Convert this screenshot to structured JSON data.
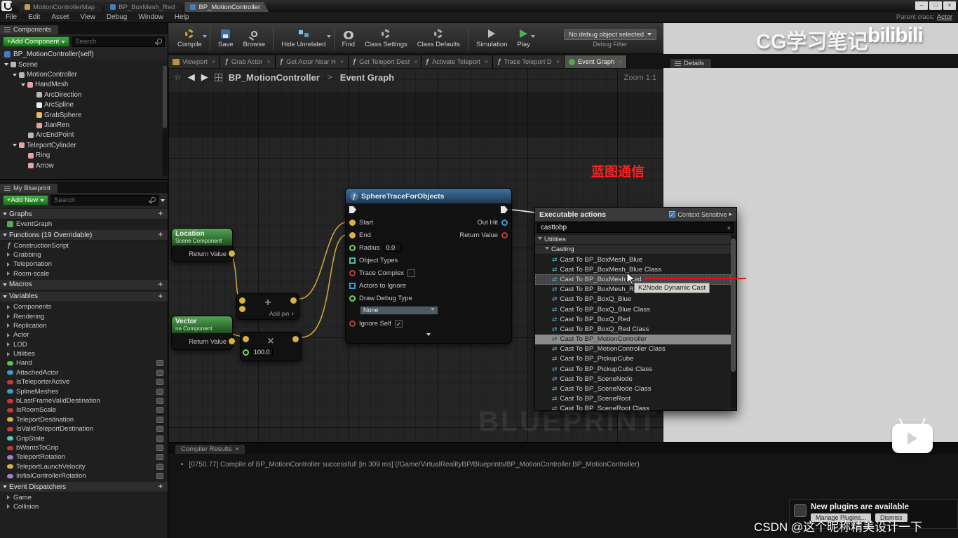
{
  "glyphs": {
    "plus": "+",
    "check": "✓",
    "fn": "ƒ",
    "cast": "⇄",
    "close": "×",
    "bullet": "•",
    "star": "☆",
    "back": "◀",
    "forward": "▶",
    "context_arrow": "▸",
    "window_min": "–",
    "window_max": "□",
    "window_close": "×"
  },
  "colors": {
    "accent_green": "#3fae3f",
    "annotation_red": "#ee1111",
    "vector_gold": "#d8b33f",
    "bool_red": "#c23b3b",
    "object_blue": "#3f9bd8",
    "node_header_blue": "#3e719f",
    "node_header_green": "#55a255"
  },
  "window": {
    "doc_tabs": [
      {
        "label": "MotionControllerMap",
        "icon": "level-icon",
        "active": false
      },
      {
        "label": "BP_BoxMesh_Red",
        "icon": "blueprint-icon",
        "active": false
      },
      {
        "label": "BP_MotionController",
        "icon": "blueprint-icon",
        "active": true
      }
    ],
    "menu_items": [
      "File",
      "Edit",
      "Asset",
      "View",
      "Debug",
      "Window",
      "Help"
    ],
    "parent_class_label": "Parent class:",
    "parent_class_value": "Actor"
  },
  "components_panel": {
    "tab_label": "Components",
    "add_button_label": "+Add Component",
    "search_placeholder": "Search",
    "root_label": "BP_MotionController(self)",
    "tree": [
      {
        "label": "Scene",
        "depth": 0,
        "expander": true,
        "color": "#b8b8b8"
      },
      {
        "label": "MotionController",
        "depth": 1,
        "expander": true,
        "color": "#b8b8b8"
      },
      {
        "label": "HandMesh",
        "depth": 2,
        "expander": true,
        "color": "#e8a1a1"
      },
      {
        "label": "ArcDirection",
        "depth": 3,
        "expander": false,
        "color": "#b8b8b8"
      },
      {
        "label": "ArcSpline",
        "depth": 3,
        "expander": false,
        "color": "#f0f0f0"
      },
      {
        "label": "GrabSphere",
        "depth": 3,
        "expander": false,
        "color": "#f0b860"
      },
      {
        "label": "JianRen",
        "depth": 3,
        "expander": false,
        "color": "#e8a1a1"
      },
      {
        "label": "ArcEndPoint",
        "depth": 2,
        "expander": false,
        "color": "#b8b8b8"
      },
      {
        "label": "TeleportCylinder",
        "depth": 1,
        "expander": true,
        "color": "#e8a1a1"
      },
      {
        "label": "Ring",
        "depth": 2,
        "expander": false,
        "color": "#e8a1a1"
      },
      {
        "label": "Arrow",
        "depth": 2,
        "expander": false,
        "color": "#e8a1a1"
      }
    ]
  },
  "myblueprint_panel": {
    "tab_label": "My Blueprint",
    "add_button_label": "+Add New",
    "search_placeholder": "Search",
    "sections": [
      {
        "label": "Graphs",
        "items": [
          {
            "label": "EventGraph",
            "type": "graph"
          }
        ]
      },
      {
        "label": "Functions (19 Overridable)",
        "items": [
          {
            "label": "ConstructionScript",
            "type": "function"
          },
          {
            "label": "Grabbing",
            "type": "category"
          },
          {
            "label": "Teleportation",
            "type": "category"
          },
          {
            "label": "Room-scale",
            "type": "category"
          }
        ]
      },
      {
        "label": "Macros",
        "items": []
      },
      {
        "label": "Variables",
        "items": [
          {
            "label": "Components",
            "type": "category"
          },
          {
            "label": "Rendering",
            "type": "category"
          },
          {
            "label": "Replication",
            "type": "category"
          },
          {
            "label": "Actor",
            "type": "category"
          },
          {
            "label": "LOD",
            "type": "category"
          },
          {
            "label": "Utilities",
            "type": "category"
          },
          {
            "label": "Hand",
            "type": "variable",
            "pin_color": "#57c757",
            "badge": true
          },
          {
            "label": "AttachedActor",
            "type": "variable",
            "pin_color": "#3f9bd8",
            "badge": true
          },
          {
            "label": "IsTeleporterActive",
            "type": "variable",
            "pin_color": "#c23b3b",
            "badge": true
          },
          {
            "label": "SplineMeshes",
            "type": "variable",
            "pin_color": "#3f9bd8",
            "badge": true
          },
          {
            "label": "bLastFrameValidDestination",
            "type": "variable",
            "pin_color": "#c23b3b",
            "badge": true
          },
          {
            "label": "IsRoomScale",
            "type": "variable",
            "pin_color": "#c23b3b",
            "badge": true
          },
          {
            "label": "TeleportDestination",
            "type": "variable",
            "pin_color": "#d8b33f",
            "badge": true
          },
          {
            "label": "IsValidTeleportDestination",
            "type": "variable",
            "pin_color": "#c23b3b",
            "badge": true
          },
          {
            "label": "GripState",
            "type": "variable",
            "pin_color": "#57c7b8",
            "badge": true
          },
          {
            "label": "bWantsToGrip",
            "type": "variable",
            "pin_color": "#c23b3b",
            "badge": true
          },
          {
            "label": "TeleportRotation",
            "type": "variable",
            "pin_color": "#9d7fd3",
            "badge": true
          },
          {
            "label": "TeleportLaunchVelocity",
            "type": "variable",
            "pin_color": "#d8b33f",
            "badge": true
          },
          {
            "label": "InitialControllerRotation",
            "type": "variable",
            "pin_color": "#9d7fd3",
            "badge": true
          }
        ]
      },
      {
        "label": "Event Dispatchers",
        "items": [
          {
            "label": "Game",
            "type": "category"
          },
          {
            "label": "Collision",
            "type": "category"
          }
        ]
      }
    ]
  },
  "toolbar": {
    "buttons": [
      {
        "label": "Compile",
        "icon": "compile-icon",
        "dropdown": true
      },
      {
        "label": "Save",
        "icon": "save-icon",
        "dropdown": false
      },
      {
        "label": "Browse",
        "icon": "browse-icon",
        "dropdown": false
      },
      {
        "label": "Hide Unrelated",
        "icon": "hide-unrelated-icon",
        "dropdown": true
      },
      {
        "label": "Find",
        "icon": "find-icon",
        "dropdown": false
      },
      {
        "label": "Class Settings",
        "icon": "class-settings-icon",
        "dropdown": false
      },
      {
        "label": "Class Defaults",
        "icon": "class-defaults-icon",
        "dropdown": false
      },
      {
        "label": "Simulation",
        "icon": "simulation-icon",
        "dropdown": false
      },
      {
        "label": "Play",
        "icon": "play-icon",
        "dropdown": true
      }
    ],
    "separators_after": [
      0,
      2,
      3,
      6
    ],
    "debug_dropdown_value": "No debug object selected",
    "debug_filter_label": "Debug Filter"
  },
  "graph_tabs": [
    {
      "label": "Viewport",
      "icon": "viewport-icon",
      "active": false
    },
    {
      "label": "Grab Actor",
      "icon": "function-icon",
      "active": false
    },
    {
      "label": "Get Actor Near H",
      "icon": "function-icon",
      "active": false
    },
    {
      "label": "Get Teleport Dest",
      "icon": "function-icon",
      "active": false
    },
    {
      "label": "Activate Teleport",
      "icon": "function-icon",
      "active": false
    },
    {
      "label": "Trace Teleport D",
      "icon": "function-icon",
      "active": false
    },
    {
      "label": "Event Graph",
      "icon": "event-graph-icon",
      "active": true
    }
  ],
  "details_panel": {
    "tab_label": "Details"
  },
  "graph": {
    "breadcrumb_root": "BP_MotionController",
    "breadcrumb_sep": ">",
    "breadcrumb_current": "Event Graph",
    "zoom_label": "Zoom 1:1",
    "annotation_text": "蓝图通信",
    "watermark": "BLUEPRINT",
    "nodes": {
      "sphere_trace": {
        "title": "SphereTraceForObjects",
        "rows": [
          {
            "left_pin": "exec",
            "right_pin": "exec"
          },
          {
            "left_pin": "vector",
            "left_label": "Start",
            "right_label": "Out Hit",
            "right_pin": "struct"
          },
          {
            "left_pin": "vector",
            "left_label": "End",
            "right_label": "Return Value",
            "right_pin": "bool"
          },
          {
            "left_pin": "float",
            "left_label": "Radius",
            "control": "field",
            "value": "0.0"
          },
          {
            "left_pin": "array-enum",
            "left_label": "Object Types"
          },
          {
            "left_pin": "bool",
            "left_label": "Trace Complex",
            "control": "checkbox",
            "checked": false
          },
          {
            "left_pin": "array-object",
            "left_label": "Actors to Ignore"
          },
          {
            "left_pin": "enum",
            "left_label": "Draw Debug Type",
            "control": "dropdown",
            "value": "None"
          },
          {
            "left_pin": "bool",
            "left_label": "Ignore Self",
            "control": "checkbox",
            "checked": true
          }
        ]
      },
      "location_getter": {
        "title": "Location",
        "subtitle": "Scene Component",
        "output_label": "Return Value"
      },
      "vector_getter": {
        "title": "Vector",
        "subtitle": "ne Component",
        "output_label": "Return Value"
      },
      "add_node": {
        "symbol": "+",
        "add_pin_label": "Add pin"
      },
      "multiply_node": {
        "symbol": "×",
        "value": "100.0"
      }
    }
  },
  "context_menu": {
    "title": "Executable actions",
    "context_sensitive_label": "Context Sensitive",
    "search_value": "casttobp",
    "groups": [
      "Utilities",
      "Casting"
    ],
    "items": [
      "Cast To BP_BoxMesh_Blue",
      "Cast To BP_BoxMesh_Blue Class",
      "Cast To BP_BoxMesh_Red",
      "Cast To BP_BoxMesh_Red Class",
      "Cast To BP_BoxQ_Blue",
      "Cast To BP_BoxQ_Blue Class",
      "Cast To BP_BoxQ_Red",
      "Cast To BP_BoxQ_Red Class",
      "Cast To BP_MotionController",
      "Cast To BP_MotionController Class",
      "Cast To BP_PickupCube",
      "Cast To BP_PickupCube Class",
      "Cast To BP_SceneNode",
      "Cast To BP_SceneNode Class",
      "Cast To BP_SceneRoot",
      "Cast To BP_SceneRoot Class"
    ],
    "hover_index": 2,
    "selected_index": 8,
    "tooltip": "K2Node Dynamic Cast"
  },
  "compiler_panel": {
    "tab_label": "Compiler Results",
    "message": "[0750.77] Compile of BP_MotionController successful! [in 309 ms] (/Game/VirtualRealityBP/Blueprints/BP_MotionController.BP_MotionController)"
  },
  "overlays": {
    "cg_watermark": "CG学习笔记",
    "bilibili_text": "bilibili",
    "csdn_text": "CSDN @这个昵称精美设计一下",
    "toast_title": "New plugins are available",
    "toast_manage_label": "Manage Plugins...",
    "toast_dismiss_label": "Dismiss"
  }
}
